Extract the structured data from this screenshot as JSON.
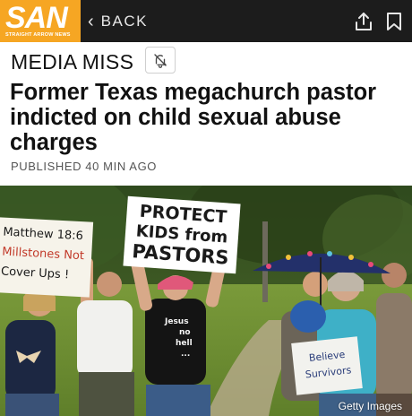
{
  "header": {
    "logo_text": "SAN",
    "logo_subtitle": "STRAIGHT ARROW NEWS",
    "back_label": "BACK",
    "colors": {
      "bar": "#1c1c1c",
      "logo": "#f6a623"
    },
    "icons": [
      "chevron-left-icon",
      "share-icon",
      "bookmark-icon"
    ]
  },
  "section": {
    "label_prefix": "M",
    "label_e": "E",
    "label_suffix": "DIA MISS",
    "mute_icon": "bell-off-icon"
  },
  "article": {
    "headline": "Former Texas megachurch pastor indicted on child sexual abuse charges",
    "published": "PUBLISHED 40 MIN AGO"
  },
  "photo": {
    "credit": "Getty Images",
    "signs": {
      "center": [
        "PROTECT",
        "KIDS from",
        "PASTORS"
      ],
      "left": [
        "Matthew 18:6",
        "Millstones Not",
        "Cover Ups !"
      ],
      "right": [
        "Believe",
        "Survivors"
      ],
      "shirt": [
        "Jesus",
        "no",
        "hell",
        "..."
      ]
    }
  }
}
